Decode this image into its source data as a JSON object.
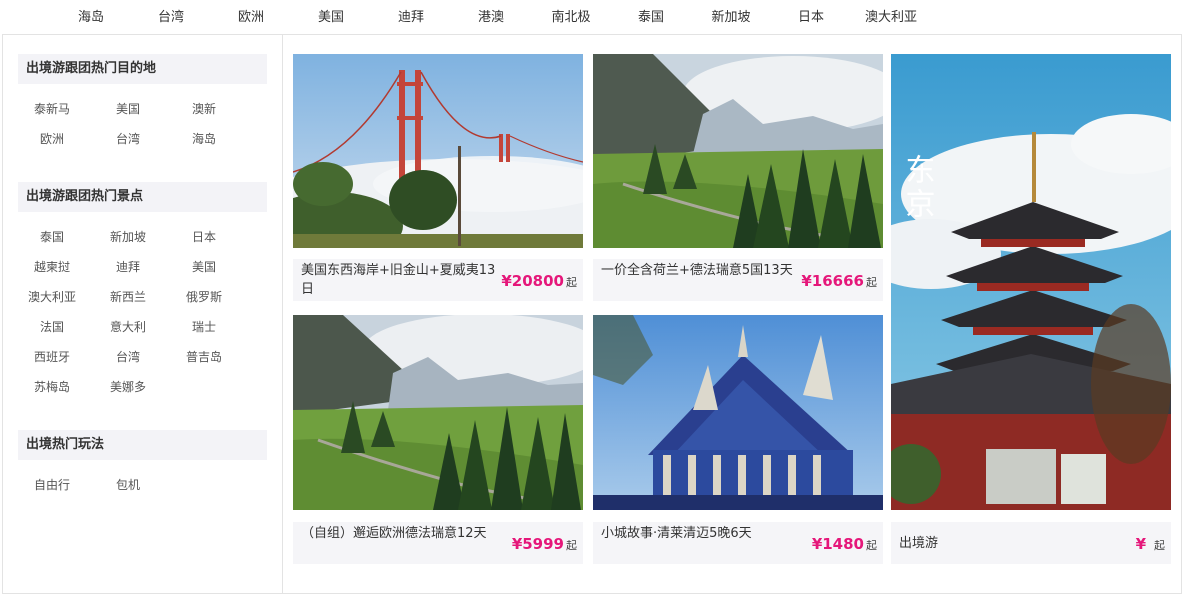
{
  "topnav": [
    "海岛",
    "台湾",
    "欧洲",
    "美国",
    "迪拜",
    "港澳",
    "南北极",
    "泰国",
    "新加坡",
    "日本",
    "澳大利亚"
  ],
  "sidebar": {
    "sections": [
      {
        "title": "出境游跟团热门目的地",
        "links": [
          "泰新马",
          "美国",
          "澳新",
          "欧洲",
          "台湾",
          "海岛"
        ]
      },
      {
        "title": "出境游跟团热门景点",
        "links": [
          "泰国",
          "新加坡",
          "日本",
          "越柬挝",
          "迪拜",
          "美国",
          "澳大利亚",
          "新西兰",
          "俄罗斯",
          "法国",
          "意大利",
          "瑞士",
          "西班牙",
          "台湾",
          "普吉岛",
          "苏梅岛",
          "美娜多"
        ]
      },
      {
        "title": "出境热门玩法",
        "links": [
          "自由行",
          "包机"
        ]
      }
    ]
  },
  "cards": [
    {
      "title": "美国东西海岸+旧金山+夏威夷13日",
      "price": "¥20800",
      "suffix": "起",
      "image": "golden-gate-bridge-fog"
    },
    {
      "title": "一价全含荷兰+德法瑞意5国13天",
      "price": "¥16666",
      "suffix": "起",
      "image": "alpine-valley"
    },
    {
      "title": "（自组）邂逅欧洲德法瑞意12天",
      "price": "¥5999",
      "suffix": "起",
      "image": "alpine-meadow-path"
    },
    {
      "title": "小城故事·清莱清迈5晚6天",
      "price": "¥1480",
      "suffix": "起",
      "image": "blue-temple-chiang-rai"
    }
  ],
  "feature": {
    "title": "出境游",
    "price": "¥",
    "suffix": "起",
    "image_text": "东京",
    "image": "tokyo-pagoda"
  }
}
